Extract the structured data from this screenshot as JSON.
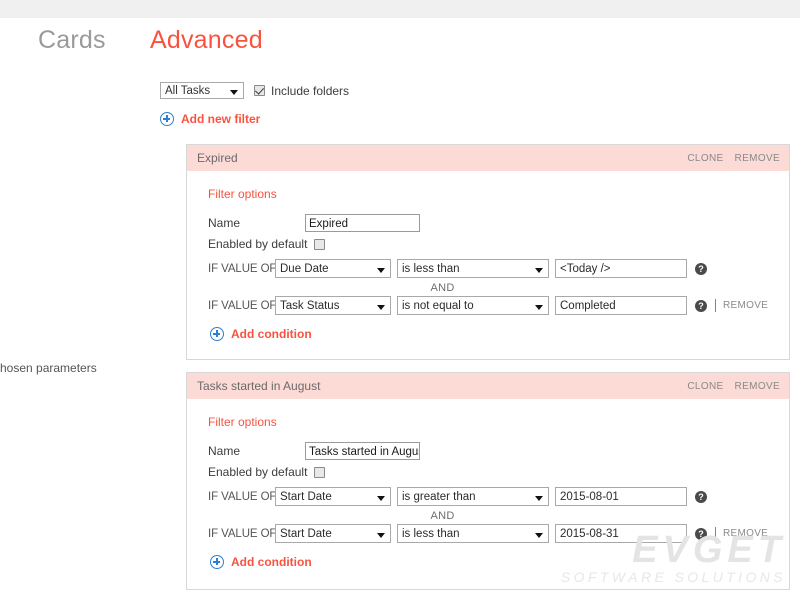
{
  "header": {
    "tab_cards": "Cards",
    "tab_advanced": "Advanced"
  },
  "edge_text": "chosen parameters",
  "toolbar": {
    "scope_select_value": "All Tasks",
    "include_folders_label": "Include folders",
    "include_folders_checked": true,
    "add_new_filter_label": "Add new filter"
  },
  "labels": {
    "filter_options": "Filter options",
    "name": "Name",
    "enabled_by_default": "Enabled by default",
    "if_value_of": "IF VALUE OF",
    "and": "AND",
    "add_condition": "Add condition",
    "clone": "CLONE",
    "remove": "REMOVE",
    "help": "?"
  },
  "colors": {
    "accent": "#f9533f",
    "panel_header": "#fcdad6",
    "icon_blue": "#2f7fd1",
    "muted_text": "#8a8a8a"
  },
  "filters": [
    {
      "title": "Expired",
      "name_value": "Expired",
      "enabled_by_default": false,
      "conditions": [
        {
          "field": "Due Date",
          "operator": "is less than",
          "value": "<Today />",
          "has_remove": false
        },
        {
          "field": "Task Status",
          "operator": "is not equal to",
          "value": "Completed",
          "has_remove": true
        }
      ]
    },
    {
      "title": "Tasks started in August",
      "name_value": "Tasks started in August",
      "enabled_by_default": false,
      "conditions": [
        {
          "field": "Start Date",
          "operator": "is greater than",
          "value": "2015-08-01",
          "has_remove": false
        },
        {
          "field": "Start Date",
          "operator": "is less than",
          "value": "2015-08-31",
          "has_remove": true
        }
      ]
    }
  ],
  "watermark": {
    "main": "EVGET",
    "sub": "SOFTWARE SOLUTIONS"
  }
}
